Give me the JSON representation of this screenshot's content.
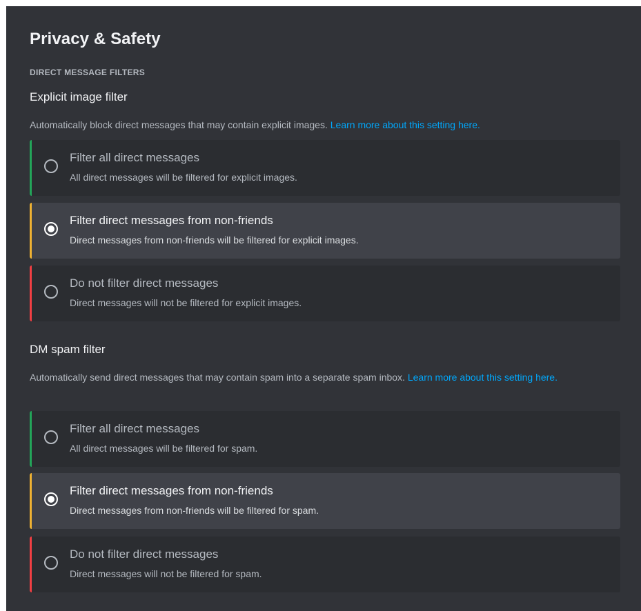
{
  "page": {
    "title": "Privacy & Safety"
  },
  "section": {
    "header": "DIRECT MESSAGE FILTERS"
  },
  "explicit_filter": {
    "title": "Explicit image filter",
    "description": "Automatically block direct messages that may contain explicit images.",
    "link": "Learn more about this setting here.",
    "options": [
      {
        "label": "Filter all direct messages",
        "description": "All direct messages will be filtered for explicit images.",
        "selected": false,
        "accent": "#23a559"
      },
      {
        "label": "Filter direct messages from non-friends",
        "description": "Direct messages from non-friends will be filtered for explicit images.",
        "selected": true,
        "accent": "#f0b232"
      },
      {
        "label": "Do not filter direct messages",
        "description": "Direct messages will not be filtered for explicit images.",
        "selected": false,
        "accent": "#f23f43"
      }
    ]
  },
  "spam_filter": {
    "title": "DM spam filter",
    "description": "Automatically send direct messages that may contain spam into a separate spam inbox.",
    "link": "Learn more about this setting here.",
    "options": [
      {
        "label": "Filter all direct messages",
        "description": "All direct messages will be filtered for spam.",
        "selected": false,
        "accent": "#23a559"
      },
      {
        "label": "Filter direct messages from non-friends",
        "description": "Direct messages from non-friends will be filtered for spam.",
        "selected": true,
        "accent": "#f0b232"
      },
      {
        "label": "Do not filter direct messages",
        "description": "Direct messages will not be filtered for spam.",
        "selected": false,
        "accent": "#f23f43"
      }
    ]
  },
  "colors": {
    "background": "#313338",
    "option_background": "#2b2d31",
    "option_selected_background": "#404249",
    "link": "#00a8fc"
  }
}
